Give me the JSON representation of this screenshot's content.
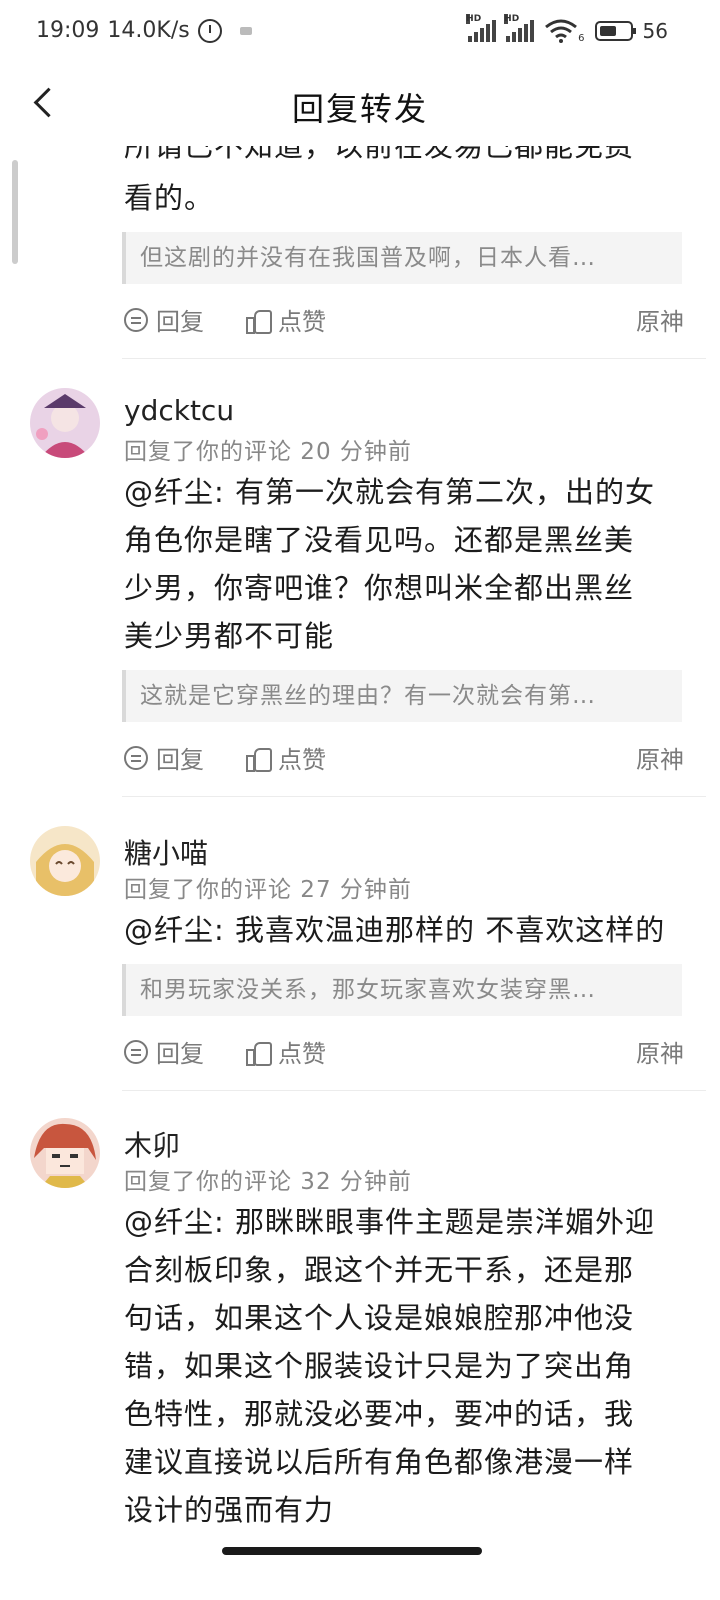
{
  "status_bar": {
    "time": "19:09",
    "speed": "14.0K/s",
    "hd1": "HD",
    "hd2": "HD",
    "wifi_badge": "6",
    "battery": "56"
  },
  "header": {
    "title": "回复转发"
  },
  "top_partial": {
    "clipped_line": "所谓已不知道，以前在发易已都能免费",
    "text_line": "看的。",
    "quote": "但这剧的并没有在我国普及啊，日本人看…",
    "reply_label": "回复",
    "like_label": "点赞",
    "source_label": "原神"
  },
  "comments": [
    {
      "username": "ydcktcu",
      "meta": "回复了你的评论 20 分钟前",
      "lines": [
        "@纤尘: 有第一次就会有第二次，出的女",
        "角色你是瞎了没看见吗。还都是黑丝美",
        "少男，你寄吧谁？你想叫米全都出黑丝",
        "美少男都不可能"
      ],
      "quote": "这就是它穿黑丝的理由？有一次就会有第…",
      "reply_label": "回复",
      "like_label": "点赞",
      "source_label": "原神"
    },
    {
      "username": "糖小喵",
      "meta": "回复了你的评论 27 分钟前",
      "lines": [
        "@纤尘: 我喜欢温迪那样的 不喜欢这样的"
      ],
      "quote": "和男玩家没关系，那女玩家喜欢女装穿黑…",
      "reply_label": "回复",
      "like_label": "点赞",
      "source_label": "原神"
    },
    {
      "username": "木卯",
      "meta": "回复了你的评论 32 分钟前",
      "lines": [
        "@纤尘: 那眯眯眼事件主题是崇洋媚外迎",
        "合刻板印象，跟这个并无干系，还是那",
        "句话，如果这个人设是娘娘腔那冲他没",
        "错，如果这个服装设计只是为了突出角",
        "色特性，那就没必要冲，要冲的话，我",
        "建议直接说以后所有角色都像港漫一样",
        "设计的强而有力"
      ]
    }
  ]
}
